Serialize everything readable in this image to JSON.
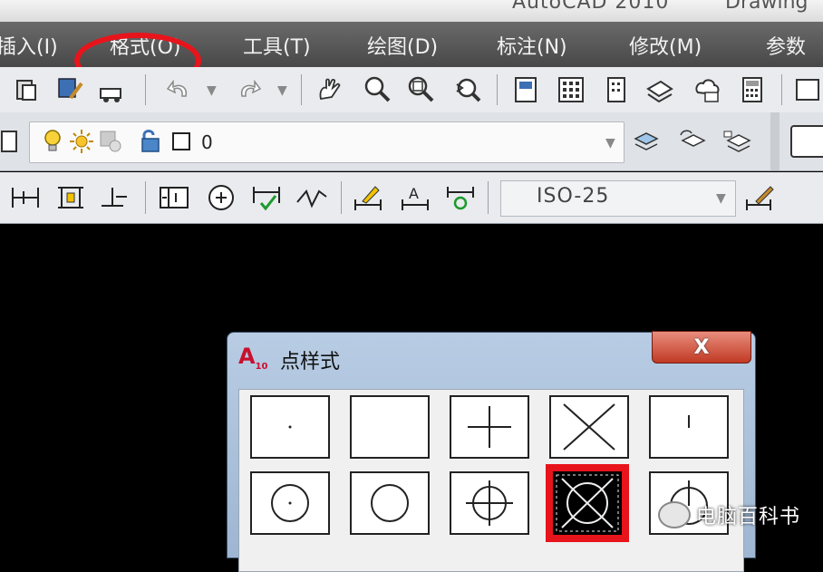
{
  "window": {
    "app_title": "AutoCAD 2010",
    "doc_title": "Drawing"
  },
  "menu": {
    "items": [
      "插入(I)",
      "格式(O)",
      "工具(T)",
      "绘图(D)",
      "标注(N)",
      "修改(M)",
      "参数"
    ]
  },
  "layer_toolbar": {
    "current_layer": "0"
  },
  "dim_toolbar": {
    "dim_style": "ISO-25"
  },
  "dialog": {
    "title": "点样式",
    "close_label": "X"
  },
  "watermark": {
    "text": "电脑百科书"
  },
  "colors": {
    "annotation": "#e8141b",
    "menubar": "#555555",
    "selected_cell": "#e8141b"
  }
}
